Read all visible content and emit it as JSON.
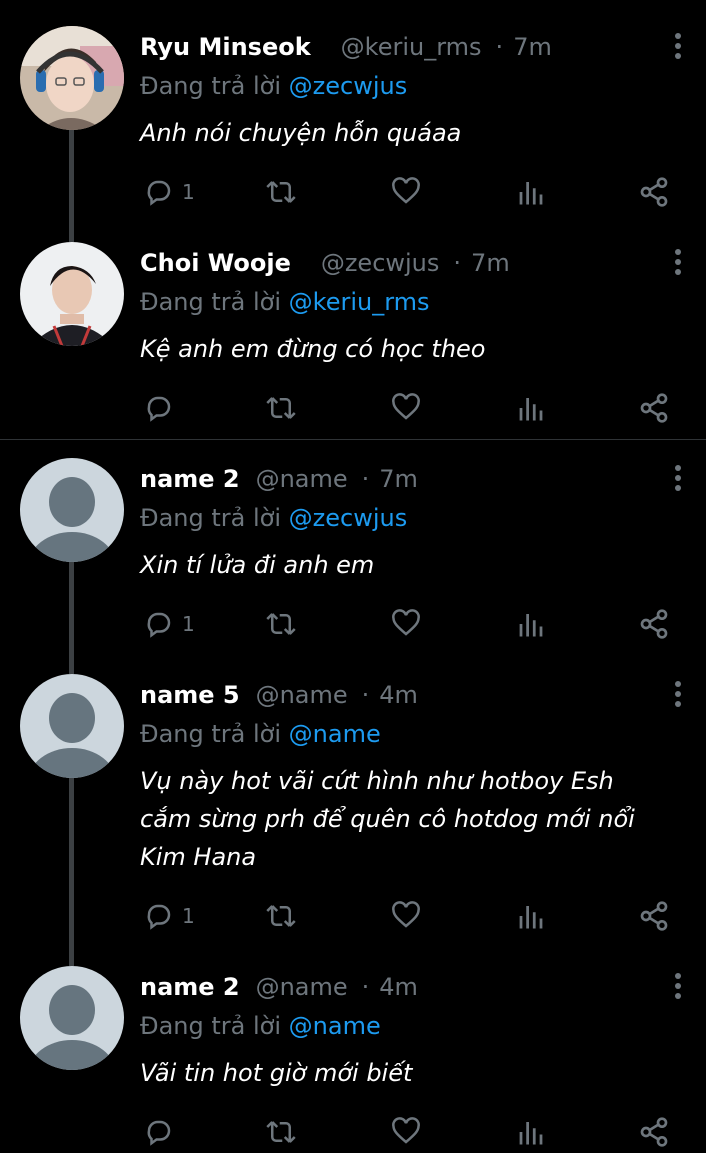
{
  "tweets": [
    {
      "name": "Ryu Minseok",
      "handle": "@keriu_rms",
      "separator": "·",
      "time": "7m",
      "reply_prefix": "Đang trả lời",
      "reply_to": "@zecwjus",
      "text": "Anh nói chuyện hỗn quáaa",
      "reply_count": "1",
      "avatar": "photo-gamer-headset"
    },
    {
      "name": "Choi Wooje",
      "handle": "@zecwjus",
      "separator": "·",
      "time": "7m",
      "reply_prefix": "Đang trả lời",
      "reply_to": "@keriu_rms",
      "text": "Kệ anh em đừng có học theo",
      "reply_count": "",
      "avatar": "photo-player-jersey"
    },
    {
      "name": "name 2",
      "handle": "@name",
      "separator": "·",
      "time": "7m",
      "reply_prefix": "Đang trả lời",
      "reply_to": "@zecwjus",
      "text": "Xin tí lửa đi anh em",
      "reply_count": "1",
      "avatar": "default-avatar"
    },
    {
      "name": "name 5",
      "handle": "@name",
      "separator": "·",
      "time": "4m",
      "reply_prefix": "Đang trả lời",
      "reply_to": "@name",
      "text": "Vụ này hot vãi cứt hình như hotboy Esh cắm sừng prh để quên cô hotdog mới nổi Kim Hana",
      "reply_count": "1",
      "avatar": "default-avatar"
    },
    {
      "name": "name 2",
      "handle": "@name",
      "separator": "·",
      "time": "4m",
      "reply_prefix": "Đang trả lời",
      "reply_to": "@name",
      "text": "Vãi tin hot giờ mới biết",
      "reply_count": "",
      "avatar": "default-avatar"
    }
  ],
  "icons": {
    "reply": "reply-icon",
    "retweet": "retweet-icon",
    "like": "heart-icon",
    "views": "analytics-icon",
    "share": "share-icon",
    "more": "more-vertical-icon"
  },
  "colors": {
    "background": "#000000",
    "text": "#ffffff",
    "muted": "#6e767d",
    "mention": "#1d9bf0",
    "thread_line": "#3c4043",
    "default_avatar_bg": "#ccd6dd",
    "default_avatar_fg": "#66757f"
  }
}
